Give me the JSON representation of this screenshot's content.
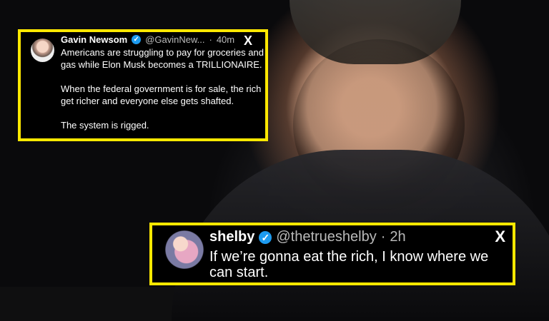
{
  "tweets": [
    {
      "display_name": "Gavin Newsom",
      "handle": "@GavinNew...",
      "separator": "·",
      "time": "40m",
      "x_label": "X",
      "verified_mark": "✓",
      "text": "Americans are struggling to pay for groceries and gas while Elon Musk becomes a TRILLIONAIRE.\n\nWhen the federal government is for sale, the rich get richer and everyone else gets shafted.\n\nThe system is rigged."
    },
    {
      "display_name": "shelby",
      "handle": "@thetrueshelby",
      "separator": "·",
      "time": "2h",
      "x_label": "X",
      "verified_mark": "✓",
      "text": "If we’re gonna eat the rich, I know where we can start."
    }
  ],
  "colors": {
    "highlight_border": "#ffe800",
    "verified": "#1d9bf0"
  },
  "icons": {
    "x": "x-icon",
    "verified": "verified-badge-icon",
    "avatar": "avatar"
  }
}
